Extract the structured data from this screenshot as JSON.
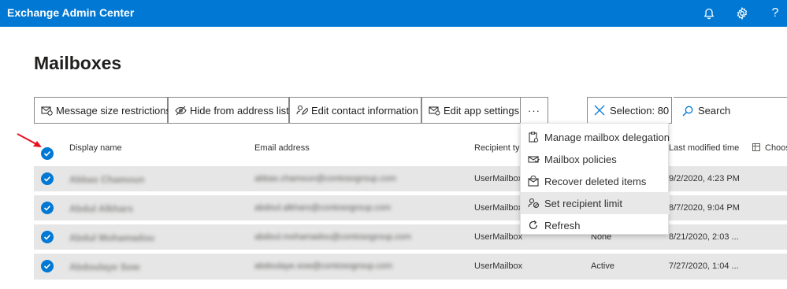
{
  "app": {
    "title": "Exchange Admin Center"
  },
  "page": {
    "title": "Mailboxes"
  },
  "toolbar": {
    "message_size": "Message size restrictions",
    "hide_address": "Hide from address list",
    "edit_contact": "Edit contact information",
    "edit_app": "Edit app settings",
    "more": "···",
    "selection": "Selection: 80",
    "search": "Search"
  },
  "menu": {
    "items": [
      {
        "label": "Manage mailbox delegation",
        "icon": "delegation-icon"
      },
      {
        "label": "Mailbox policies",
        "icon": "policy-icon"
      },
      {
        "label": "Recover deleted items",
        "icon": "recover-icon"
      },
      {
        "label": "Set recipient limit",
        "icon": "recipient-limit-icon"
      },
      {
        "label": "Refresh",
        "icon": "refresh-icon"
      }
    ]
  },
  "table": {
    "columns": {
      "display_name": "Display name",
      "email": "Email address",
      "recipient_type": "Recipient typ",
      "last_modified": "Last modified time",
      "choose": "Choos"
    },
    "rows": [
      {
        "name": "Abbas Chamoun",
        "email": "abbas.chamoun@contosogroup.com",
        "type": "UserMailbox",
        "status": "",
        "modified": "9/2/2020, 4:23 PM"
      },
      {
        "name": "Abdul Alkhars",
        "email": "abdoul.alkhars@contosogroup.com",
        "type": "UserMailbox",
        "status": "",
        "modified": "8/7/2020, 9:04 PM"
      },
      {
        "name": "Abdul Mohamadou",
        "email": "abdoul.mohamadou@contosogroup.com",
        "type": "UserMailbox",
        "status": "None",
        "modified": "8/21/2020, 2:03 ..."
      },
      {
        "name": "Abdoulaye Sow",
        "email": "abdoulaye.sow@contosogroup.com",
        "type": "UserMailbox",
        "status": "Active",
        "modified": "7/27/2020, 1:04 ..."
      }
    ]
  },
  "colors": {
    "accent": "#0078d4",
    "row_selected": "#e6e6e6",
    "arrow": "#e81123"
  }
}
